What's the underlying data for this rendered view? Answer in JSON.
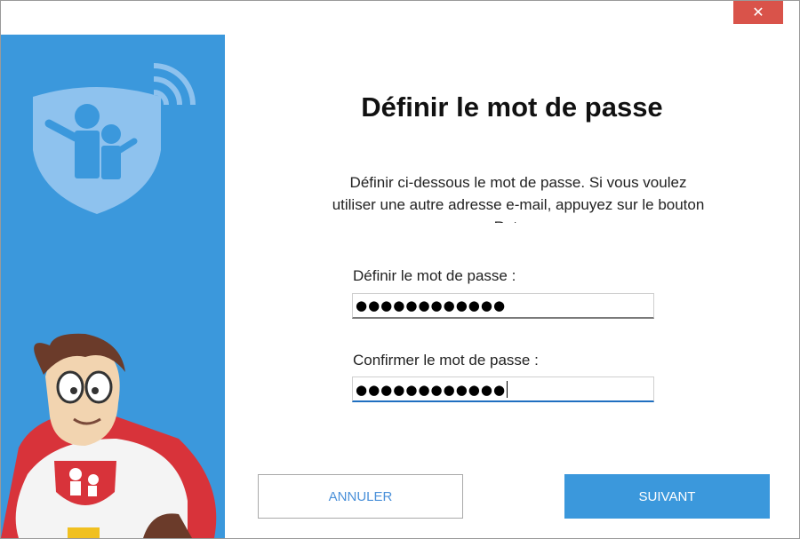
{
  "window": {
    "close_glyph": "✕"
  },
  "main": {
    "title": "Définir le mot de passe",
    "description": "Définir ci-dessous le mot de passe. Si vous voulez utiliser une autre adresse e-mail, appuyez sur le bouton Retour."
  },
  "form": {
    "password_label": "Définir le mot de passe :",
    "password_value": "●●●●●●●●●●●●",
    "confirm_label": "Confirmer le mot de passe :",
    "confirm_value": "●●●●●●●●●●●●"
  },
  "buttons": {
    "cancel": "ANNULER",
    "next": "SUIVANT"
  },
  "colors": {
    "brand_blue": "#3b98dc",
    "close_red": "#d9534a",
    "mascot_red": "#d8333a"
  },
  "icons": [
    "close-icon",
    "family-shield-logo",
    "superhero-mascot"
  ]
}
